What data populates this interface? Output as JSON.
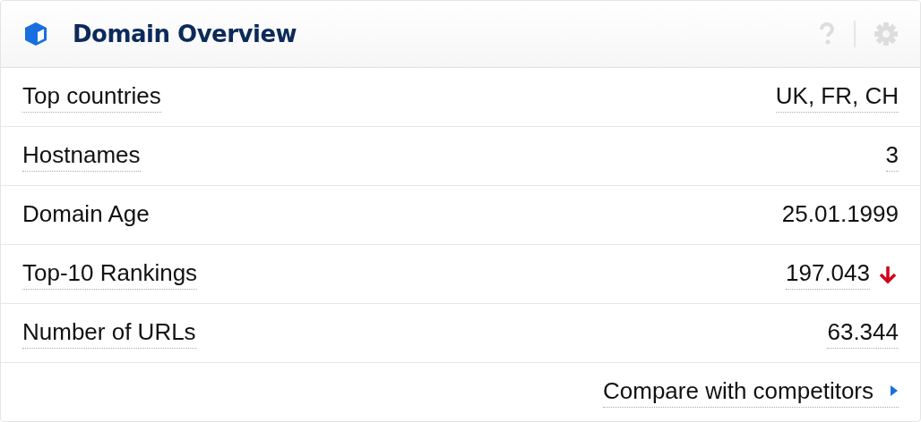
{
  "widget": {
    "title": "Domain Overview"
  },
  "rows": [
    {
      "label": "Top countries",
      "value": "UK, FR, CH",
      "underlined": true,
      "falling": false
    },
    {
      "label": "Hostnames",
      "value": "3",
      "underlined": true,
      "falling": false
    },
    {
      "label": "Domain Age",
      "value": "25.01.1999",
      "underlined": false,
      "falling": false
    },
    {
      "label": "Top-10 Rankings",
      "value": "197.043",
      "underlined": true,
      "falling": true
    },
    {
      "label": "Number of URLs",
      "value": "63.344",
      "underlined": true,
      "falling": false
    }
  ],
  "footer_link": "Compare with competitors"
}
